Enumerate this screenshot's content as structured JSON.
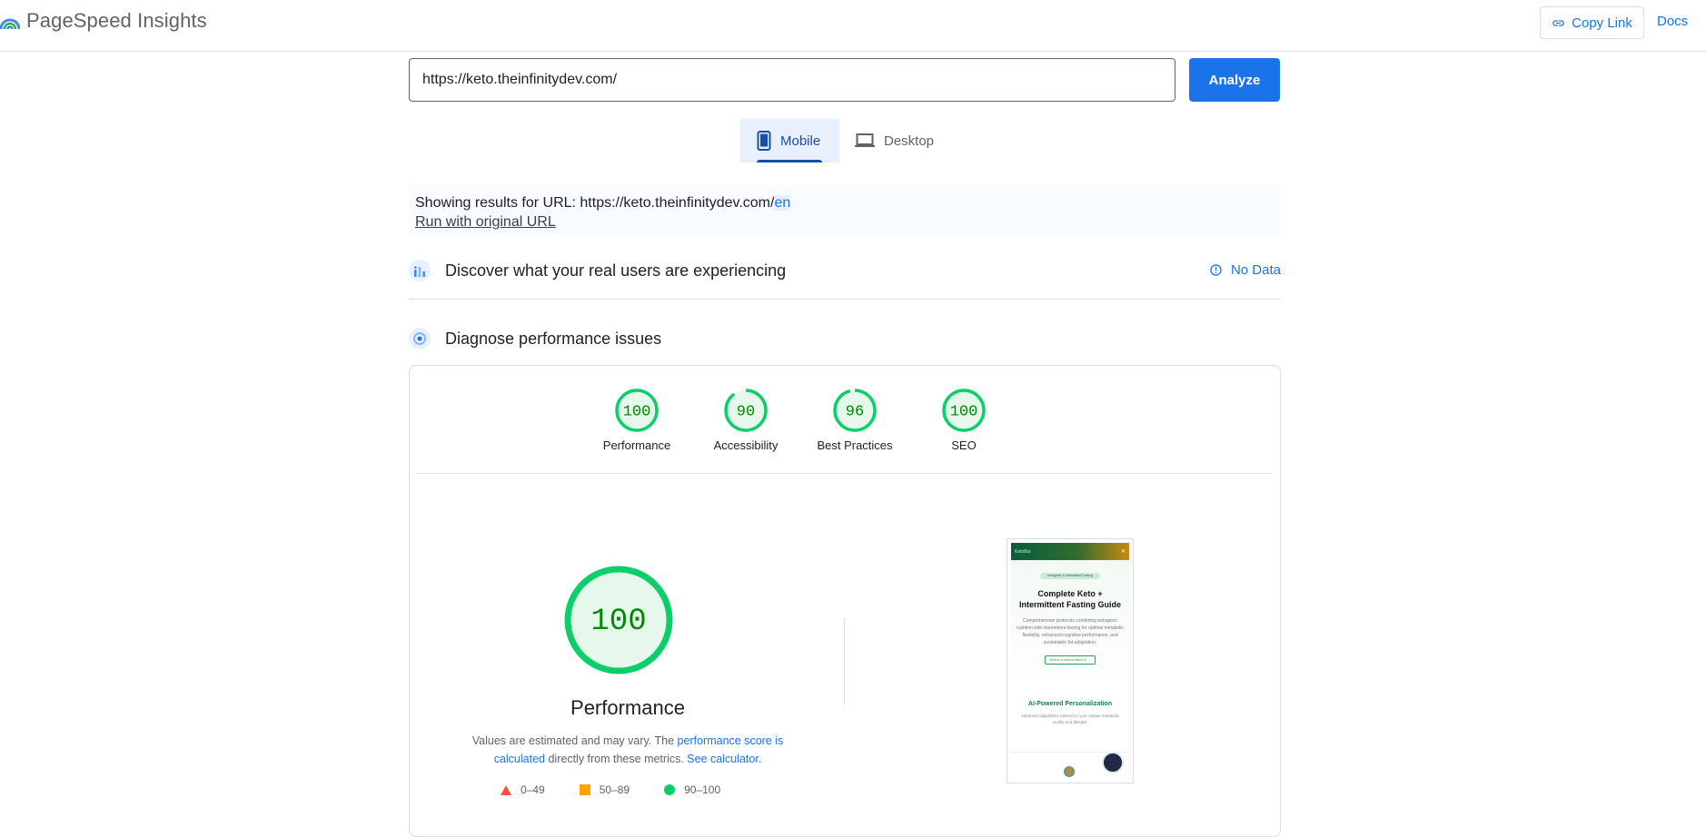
{
  "header": {
    "app_title": "PageSpeed Insights",
    "copy_link_label": "Copy Link",
    "docs_label": "Docs"
  },
  "search": {
    "url_value": "https://keto.theinfinitydev.com/",
    "analyze_label": "Analyze"
  },
  "tabs": [
    {
      "label": "Mobile",
      "selected": true,
      "icon": "smartphone-icon"
    },
    {
      "label": "Desktop",
      "selected": false,
      "icon": "laptop-icon"
    }
  ],
  "banner": {
    "prefix": "Showing results for URL: https://keto.theinfinitydev.com/",
    "highlight": "en",
    "run_original_label": "Run with original URL"
  },
  "real_users": {
    "title": "Discover what your real users are experiencing",
    "no_data_label": "No Data"
  },
  "diagnose": {
    "title": "Diagnose performance issues"
  },
  "scores": [
    {
      "label": "Performance",
      "value": 100
    },
    {
      "label": "Accessibility",
      "value": 90
    },
    {
      "label": "Best Practices",
      "value": 96
    },
    {
      "label": "SEO",
      "value": 100
    }
  ],
  "performance": {
    "score": "100",
    "title": "Performance",
    "note_1": "Values are estimated and may vary. The ",
    "note_link_1": "performance score is calculated",
    "note_2": " directly from these metrics. ",
    "note_link_2": "See calculator.",
    "legend": [
      {
        "label": "0–49",
        "shape": "triangle",
        "color": "#ff4e42"
      },
      {
        "label": "50–89",
        "shape": "square",
        "color": "#ffa400"
      },
      {
        "label": "90–100",
        "shape": "circle",
        "color": "#0cce6b"
      }
    ]
  },
  "colors": {
    "good": "#0cce6b",
    "good_fill": "#e6f7ec",
    "good_text": "#008800",
    "accent": "#1a73e8"
  },
  "thumbnail": {
    "brand": "KetoBio",
    "close": "✕",
    "pill": "Ketogenic & Intermittent Fasting",
    "heading_line1": "Complete Keto +",
    "heading_line2": "Intermittent Fasting Guide",
    "paragraph": "Comprehensive protocols combining ketogenic nutrition with intermittent fasting for optimal metabolic flexibility, enhanced cognitive performance, and sustainable fat adaptation.",
    "button": "Search a medical Band to →",
    "section_heading": "AI-Powered Personalization",
    "section_text": "Advanced algorithms tailored to your unique metabolic profile and lifestyle"
  }
}
